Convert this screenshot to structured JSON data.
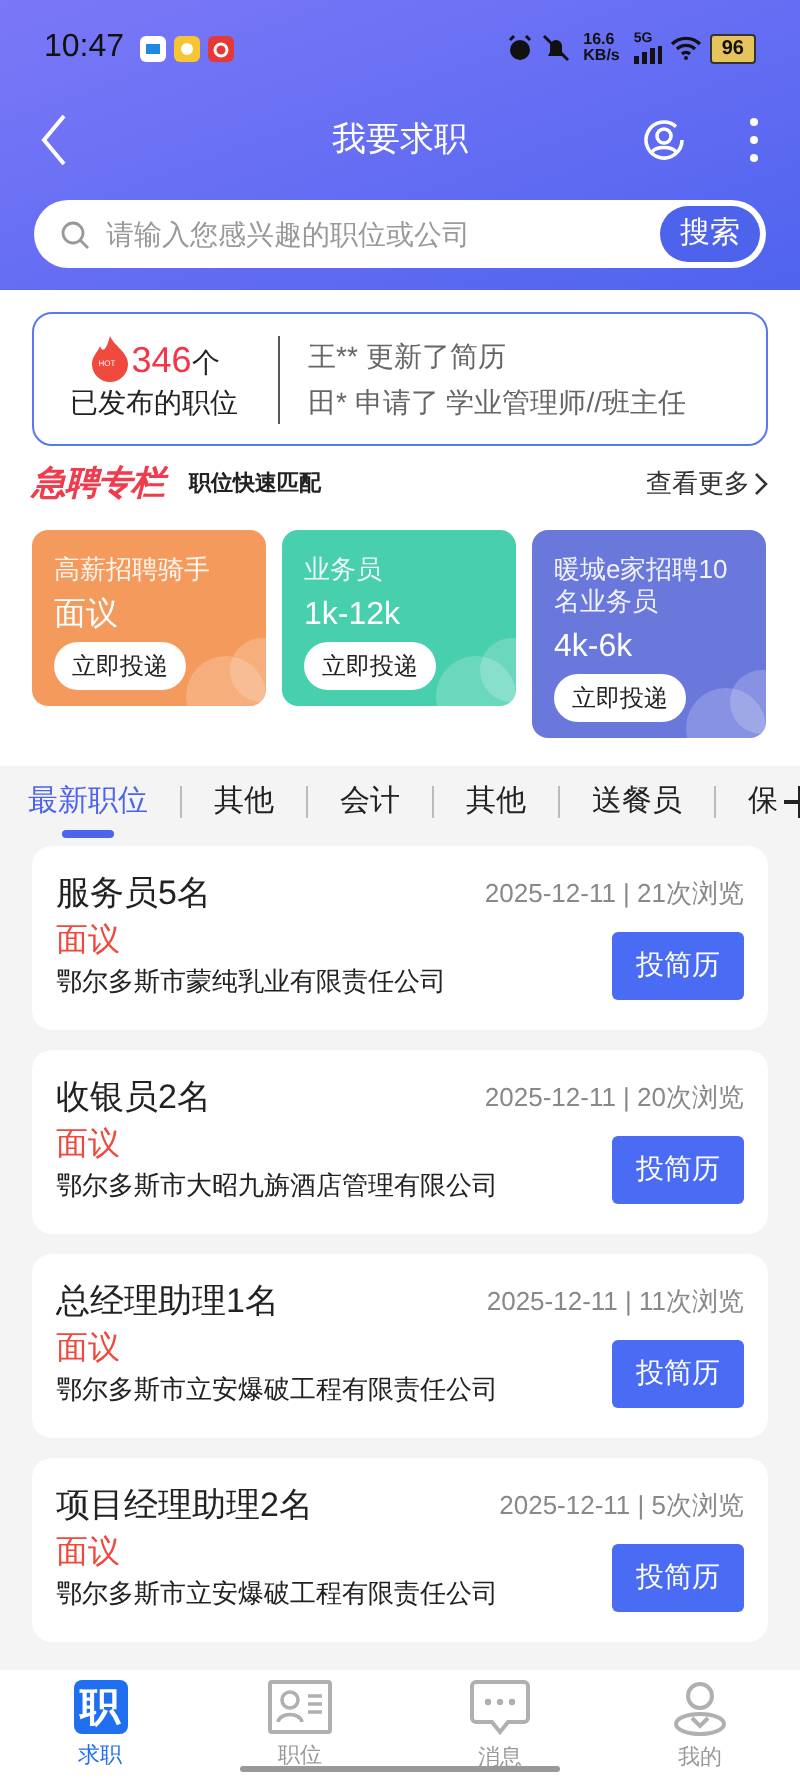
{
  "status_bar": {
    "time": "10:47",
    "speed": "16.6",
    "speed_unit": "KB/s",
    "network": "5G",
    "battery": "96"
  },
  "header": {
    "title": "我要求职"
  },
  "search": {
    "placeholder": "请输入您感兴趣的职位或公司",
    "button": "搜索"
  },
  "stats": {
    "count": "346",
    "unit": "个",
    "label": "已发布的职位",
    "badge": "HOT",
    "activity": [
      "王** 更新了简历",
      "田* 申请了 学业管理师//班主任"
    ]
  },
  "urgent": {
    "title": "急聘专栏",
    "subtitle": "职位快速匹配",
    "more": "查看更多",
    "cards": [
      {
        "title": "高薪招聘骑手",
        "salary": "面议",
        "button": "立即投递",
        "color": "#f39a5c"
      },
      {
        "title": "业务员",
        "salary": "1k-12k",
        "button": "立即投递",
        "color": "#47cfae"
      },
      {
        "title": "暖城e家招聘10名业务员",
        "salary": "4k-6k",
        "button": "立即投递",
        "color": "#6a78db"
      }
    ]
  },
  "tabs": [
    {
      "label": "最新职位",
      "selected": true
    },
    {
      "label": "其他",
      "selected": false
    },
    {
      "label": "会计",
      "selected": false
    },
    {
      "label": "其他",
      "selected": false
    },
    {
      "label": "送餐员",
      "selected": false
    },
    {
      "label": "保",
      "selected": false
    }
  ],
  "jobs": [
    {
      "title": "服务员5名",
      "meta": "2025-12-11 | 21次浏览",
      "salary": "面议",
      "company": "鄂尔多斯市蒙纯乳业有限责任公司",
      "button": "投简历"
    },
    {
      "title": "收银员2名",
      "meta": "2025-12-11 | 20次浏览",
      "salary": "面议",
      "company": "鄂尔多斯市大昭九旃酒店管理有限公司",
      "button": "投简历"
    },
    {
      "title": "总经理助理1名",
      "meta": "2025-12-11 | 11次浏览",
      "salary": "面议",
      "company": "鄂尔多斯市立安爆破工程有限责任公司",
      "button": "投简历"
    },
    {
      "title": "项目经理助理2名",
      "meta": "2025-12-11 | 5次浏览",
      "salary": "面议",
      "company": "鄂尔多斯市立安爆破工程有限责任公司",
      "button": "投简历"
    }
  ],
  "bottom_nav": [
    {
      "label": "求职",
      "icon_text": "职",
      "kind": "glyph",
      "selected": true
    },
    {
      "label": "职位",
      "kind": "card",
      "selected": false
    },
    {
      "label": "消息",
      "kind": "chat",
      "selected": false
    },
    {
      "label": "我的",
      "kind": "person",
      "selected": false
    }
  ]
}
